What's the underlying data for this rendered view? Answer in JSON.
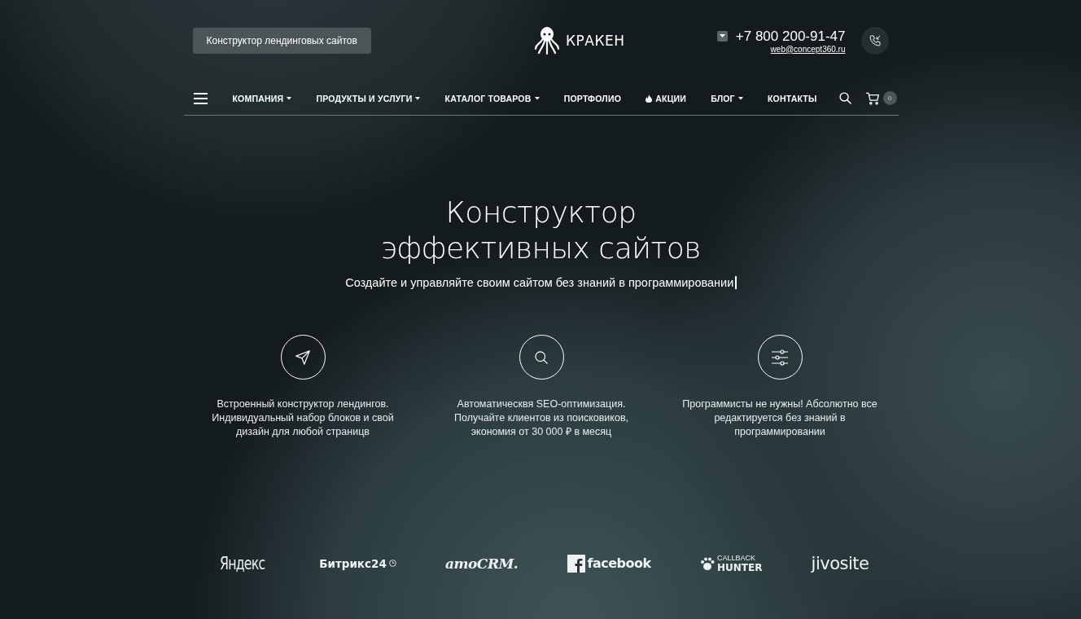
{
  "header": {
    "builder_button": "Конструктор лендинговых сайтов",
    "logo": "КРАКЕН",
    "phone": "+7 800 200-91-47",
    "email": "web@concept360.ru"
  },
  "nav": {
    "items": [
      {
        "label": "КОМПАНИЯ",
        "kind": "dropdown"
      },
      {
        "label": "ПРОДУКТЫ И УСЛУГИ",
        "kind": "dropdown"
      },
      {
        "label": "КАТАЛОГ ТОВАРОВ",
        "kind": "dropdown"
      },
      {
        "label": "ПОРТФОЛИО",
        "kind": "plain"
      },
      {
        "label": "АКЦИИ",
        "kind": "flame"
      },
      {
        "label": "БЛОГ",
        "kind": "dropdown"
      },
      {
        "label": "КОНТАКТЫ",
        "kind": "plain"
      }
    ],
    "cart_count": "0"
  },
  "hero": {
    "title_lines": [
      "Конструктор",
      "эффективных сайтов"
    ],
    "subtitle": "Создайте и управляйте своим сайтом без знаний в программировании"
  },
  "features": [
    {
      "kind": "send",
      "text": "Встроенный конструктор лендингов. Индивидуальный набор блоков и свой дизайн для любой страницв"
    },
    {
      "kind": "search",
      "text": "Автоматическвя SEO-оптимизация. Получайте клиентов из поисковиков, экономия от 30 000 ₽ в месяц"
    },
    {
      "kind": "sliders",
      "text": "Программисты не нужны! Абсолютно все редактируется без знаний в программировании"
    }
  ],
  "partners": [
    {
      "kind": "condensed",
      "lines": [
        "Яндекс"
      ]
    },
    {
      "kind": "clock",
      "lines": [
        "Битрикс24"
      ]
    },
    {
      "kind": "script",
      "lines": [
        "amoCRM."
      ]
    },
    {
      "kind": "facebook",
      "lines": [
        "facebook"
      ]
    },
    {
      "kind": "paw",
      "lines": [
        "CALLBACK",
        "HUNTER"
      ]
    },
    {
      "kind": "plain",
      "lines": [
        "jivosite"
      ]
    }
  ]
}
